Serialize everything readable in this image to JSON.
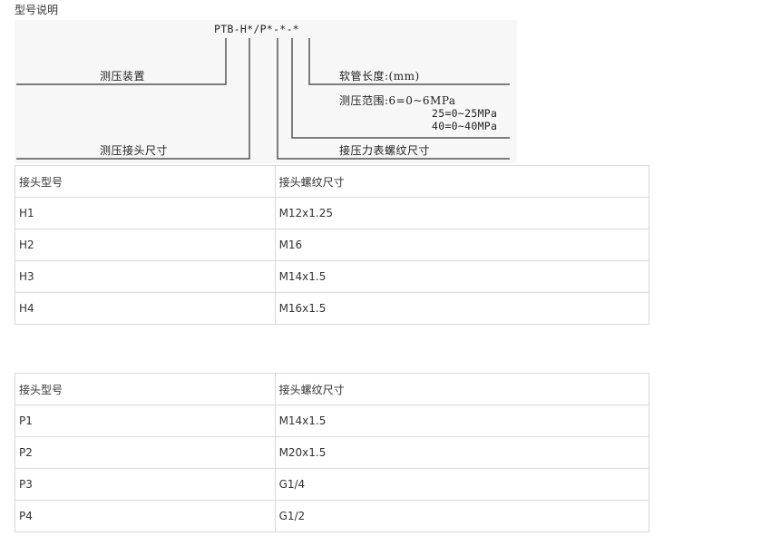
{
  "section_title": "型号说明",
  "diagram": {
    "model_code": "PTB-H*/P*-*-*",
    "label_device": "测压装置",
    "label_fitting_size": "测压接头尺寸",
    "label_hose_length": "软管长度:(mm)",
    "label_range_title": "测压范围:6=0~6MPa",
    "label_range_25": "25=0~25MPa",
    "label_range_40": "40=0~40MPa",
    "label_gauge_thread": "接压力表螺纹尺寸"
  },
  "table_h": {
    "headers": [
      "接头型号",
      "接头螺纹尺寸"
    ],
    "rows": [
      [
        "H1",
        "M12x1.25"
      ],
      [
        "H2",
        "M16"
      ],
      [
        "H3",
        "M14x1.5"
      ],
      [
        "H4",
        "M16x1.5"
      ]
    ]
  },
  "table_p": {
    "headers": [
      "接头型号",
      "接头螺纹尺寸"
    ],
    "rows": [
      [
        "P1",
        "M14x1.5"
      ],
      [
        "P2",
        "M20x1.5"
      ],
      [
        "P3",
        "G1/4"
      ],
      [
        "P4",
        "G1/2"
      ]
    ]
  }
}
